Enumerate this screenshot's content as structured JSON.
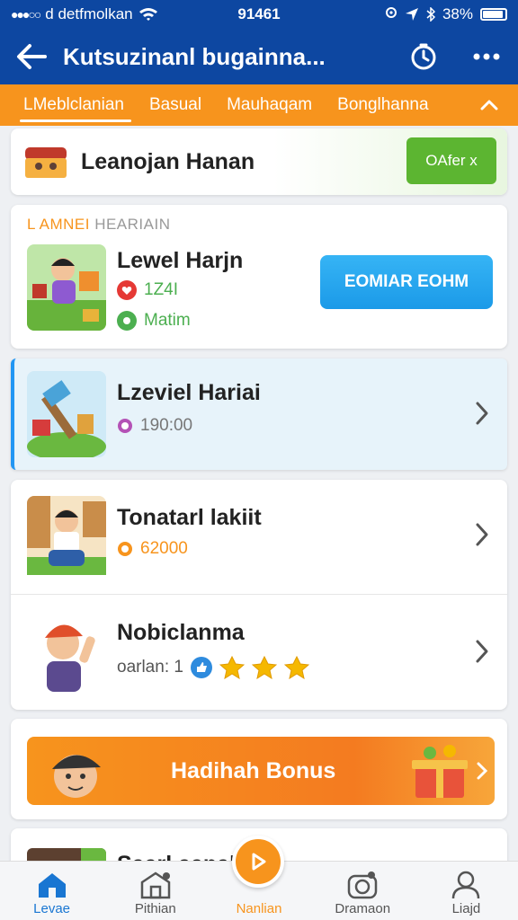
{
  "status_bar": {
    "carrier": "d detfmolkan",
    "time": "91461",
    "battery": "38%"
  },
  "app_bar": {
    "title": "Kutsuzinanl bugainna...",
    "icons": [
      "back-arrow-icon",
      "clock-icon",
      "more-icon"
    ]
  },
  "tabs": [
    {
      "label": "LMeblclanian",
      "active": true
    },
    {
      "label": "Basual",
      "active": false
    },
    {
      "label": "Mauhaqam",
      "active": false
    },
    {
      "label": "Bonglhanna",
      "active": false
    }
  ],
  "banner": {
    "label": "Leanojan Hanan",
    "button": "OAfer x"
  },
  "featured": {
    "tag_highlight": "L AMNEI",
    "tag_rest": "HEARIAIN",
    "title": "Lewel Harjn",
    "stat": "1Z4I",
    "status": "Matim",
    "button": "EOMIAR EOHM"
  },
  "selected_item": {
    "title": "Lzeviel Hariai",
    "value": "190:00"
  },
  "list_items": [
    {
      "title": "Tonatarl lakiit",
      "value": "62000"
    },
    {
      "title": "Nobiclanma",
      "value": "oarlan: 1"
    }
  ],
  "bonus": {
    "label": "Hadihah Bonus"
  },
  "peek": {
    "title": "Saarl aanalo"
  },
  "bottom_nav": [
    {
      "label": "Levae",
      "icon": "home-icon",
      "active": true
    },
    {
      "label": "Pithian",
      "icon": "shop-icon",
      "active": false
    },
    {
      "label": "Nanlian",
      "icon": "play-icon",
      "active": false
    },
    {
      "label": "Dramaon",
      "icon": "camera-icon",
      "active": false
    },
    {
      "label": "Liajd",
      "icon": "profile-icon",
      "active": false
    }
  ],
  "colors": {
    "primary": "#0d47a1",
    "accent": "#f7941d",
    "button_blue": "#1b9ae8",
    "green": "#5cb531"
  }
}
